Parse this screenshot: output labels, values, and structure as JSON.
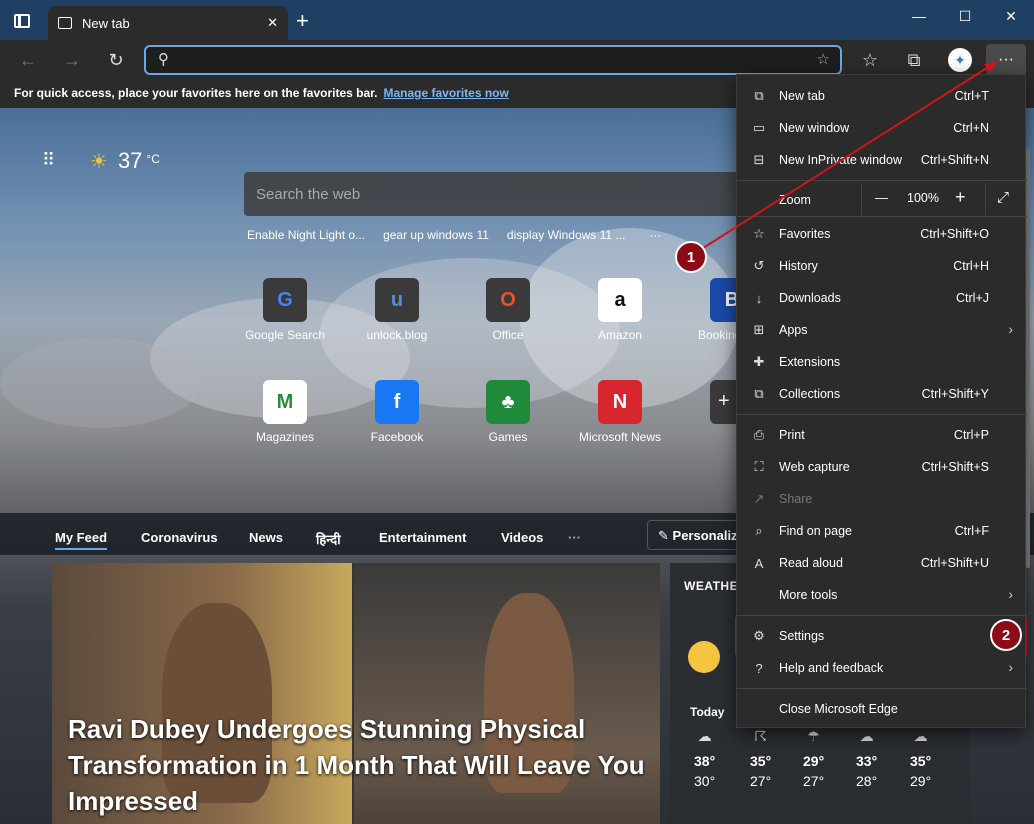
{
  "tab": {
    "title": "New tab"
  },
  "window": {
    "minimize": "—",
    "maximize": "☐",
    "close": "✕",
    "new_tab": "+"
  },
  "favbar": {
    "text": "For quick access, place your favorites here on the favorites bar.",
    "link": "Manage favorites now"
  },
  "weather_top": {
    "temp": "37",
    "unit": "°C"
  },
  "search": {
    "placeholder": "Search the web"
  },
  "suggestions": [
    "Enable Night Light o...",
    "gear up windows 11",
    "display Windows 11 ..."
  ],
  "tiles": [
    {
      "label": "Google Search",
      "glyph": "G"
    },
    {
      "label": "unlock.blog",
      "glyph": "u"
    },
    {
      "label": "Office",
      "glyph": "O"
    },
    {
      "label": "Amazon",
      "glyph": "a"
    },
    {
      "label": "Booking",
      "glyph": "B"
    },
    {
      "label": "Magazines",
      "glyph": "M"
    },
    {
      "label": "Facebook",
      "glyph": "f"
    },
    {
      "label": "Games",
      "glyph": "♣"
    },
    {
      "label": "Microsoft News",
      "glyph": "N"
    }
  ],
  "feed": {
    "tabs": [
      "My Feed",
      "Coronavirus",
      "News",
      "हिन्दी",
      "Entertainment",
      "Videos"
    ],
    "personalize": "Personalize",
    "headline": "Ravi Dubey Undergoes Stunning Physical Transformation in 1 Month That Will Leave You Impressed"
  },
  "weather_card": {
    "title": "WEATHER",
    "today": "Today",
    "days": [
      {
        "hi": "38°",
        "lo": "30°"
      },
      {
        "hi": "35°",
        "lo": "27°"
      },
      {
        "hi": "29°",
        "lo": "27°"
      },
      {
        "hi": "33°",
        "lo": "28°"
      },
      {
        "hi": "35°",
        "lo": "29°"
      }
    ]
  },
  "menu": {
    "items": [
      {
        "label": "New tab",
        "shortcut": "Ctrl+T",
        "icon": "new-tab-icon"
      },
      {
        "label": "New window",
        "shortcut": "Ctrl+N",
        "icon": "window-icon"
      },
      {
        "label": "New InPrivate window",
        "shortcut": "Ctrl+Shift+N",
        "icon": "inprivate-icon"
      },
      {
        "label": "Favorites",
        "shortcut": "Ctrl+Shift+O",
        "icon": "star-icon"
      },
      {
        "label": "History",
        "shortcut": "Ctrl+H",
        "icon": "history-icon"
      },
      {
        "label": "Downloads",
        "shortcut": "Ctrl+J",
        "icon": "download-icon"
      },
      {
        "label": "Apps",
        "shortcut": "",
        "icon": "apps-icon"
      },
      {
        "label": "Extensions",
        "shortcut": "",
        "icon": "puzzle-icon"
      },
      {
        "label": "Collections",
        "shortcut": "Ctrl+Shift+Y",
        "icon": "collections-icon"
      },
      {
        "label": "Print",
        "shortcut": "Ctrl+P",
        "icon": "printer-icon"
      },
      {
        "label": "Web capture",
        "shortcut": "Ctrl+Shift+S",
        "icon": "capture-icon"
      },
      {
        "label": "Share",
        "shortcut": "",
        "icon": "share-icon"
      },
      {
        "label": "Find on page",
        "shortcut": "Ctrl+F",
        "icon": "find-icon"
      },
      {
        "label": "Read aloud",
        "shortcut": "Ctrl+Shift+U",
        "icon": "read-aloud-icon"
      },
      {
        "label": "More tools",
        "shortcut": "",
        "icon": ""
      },
      {
        "label": "Settings",
        "shortcut": "",
        "icon": "gear-icon"
      },
      {
        "label": "Help and feedback",
        "shortcut": "",
        "icon": "help-icon"
      },
      {
        "label": "Close Microsoft Edge",
        "shortcut": "",
        "icon": ""
      }
    ],
    "zoom": {
      "label": "Zoom",
      "value": "100%",
      "minus": "—",
      "plus": "+"
    }
  },
  "annotations": {
    "step1": "1",
    "step2": "2"
  }
}
